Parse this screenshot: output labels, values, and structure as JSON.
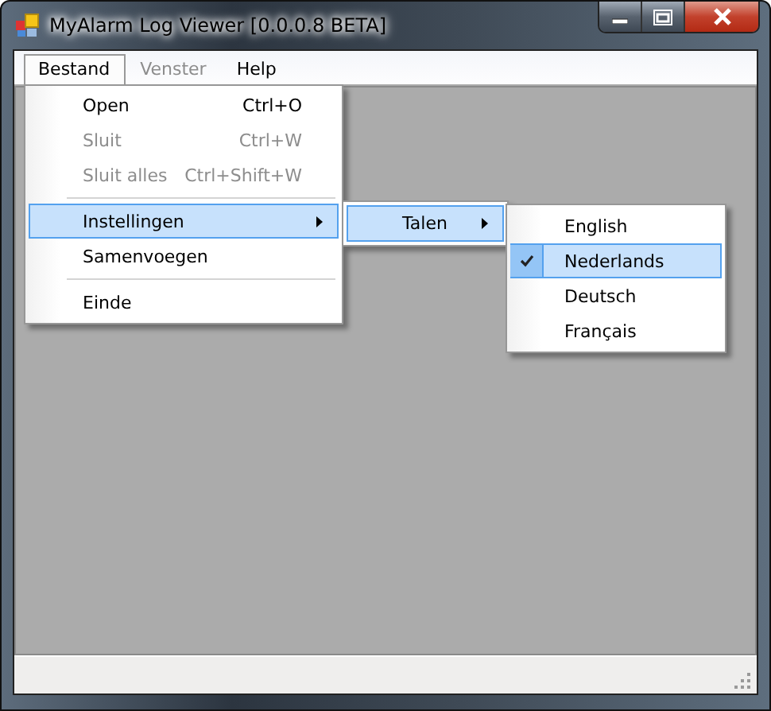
{
  "window": {
    "title": "MyAlarm Log Viewer [0.0.0.8 BETA]"
  },
  "menu_bar": [
    {
      "label": "Bestand",
      "selected": true,
      "disabled": false
    },
    {
      "label": "Venster",
      "selected": false,
      "disabled": true
    },
    {
      "label": "Help",
      "selected": false,
      "disabled": false
    }
  ],
  "file_menu": [
    {
      "kind": "item",
      "label": "Open",
      "shortcut": "Ctrl+O",
      "disabled": false,
      "selected": false
    },
    {
      "kind": "item",
      "label": "Sluit",
      "shortcut": "Ctrl+W",
      "disabled": true,
      "selected": false
    },
    {
      "kind": "item",
      "label": "Sluit alles",
      "shortcut": "Ctrl+Shift+W",
      "disabled": true,
      "selected": false
    },
    {
      "kind": "separator"
    },
    {
      "kind": "submenu",
      "label": "Instellingen",
      "disabled": false,
      "selected": true
    },
    {
      "kind": "item",
      "label": "Samenvoegen",
      "disabled": false,
      "selected": false
    },
    {
      "kind": "separator"
    },
    {
      "kind": "item",
      "label": "Einde",
      "disabled": false,
      "selected": false
    }
  ],
  "settings_menu": [
    {
      "kind": "submenu",
      "label": "Talen",
      "disabled": false,
      "selected": true
    }
  ],
  "language_menu": [
    {
      "label": "English",
      "checked": false,
      "selected": false
    },
    {
      "label": "Nederlands",
      "checked": true,
      "selected": true
    },
    {
      "label": "Deutsch",
      "checked": false,
      "selected": false
    },
    {
      "label": "Français",
      "checked": false,
      "selected": false
    }
  ]
}
